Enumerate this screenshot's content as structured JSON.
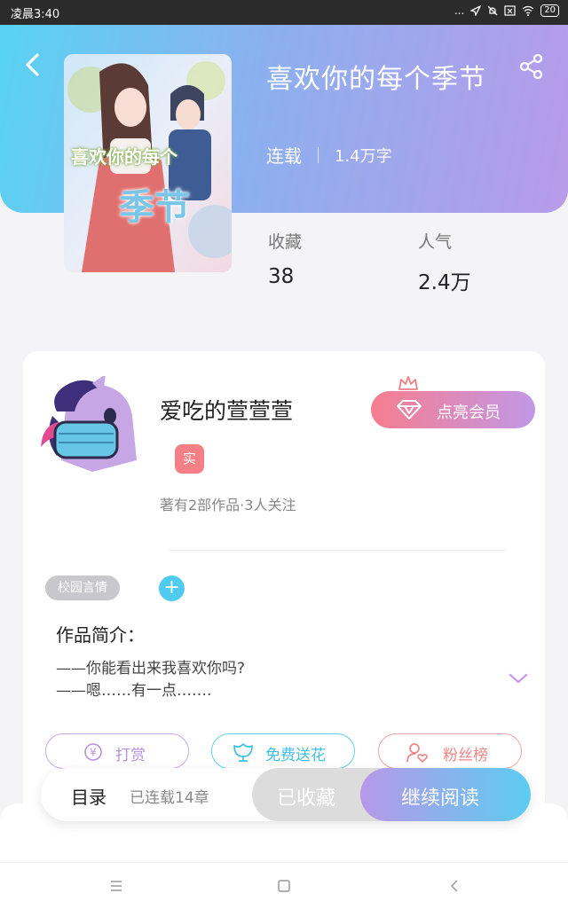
{
  "status_bar": {
    "time": "凌晨3:40",
    "dots": "...",
    "battery": "20"
  },
  "book": {
    "title": "喜欢你的每个季节",
    "status": "连载",
    "word_count": "1.4万字",
    "cover_title_line1": "喜欢你的每个",
    "cover_title_line2": "季节"
  },
  "stats": {
    "favorites": {
      "label": "收藏",
      "value": "38"
    },
    "popularity": {
      "label": "人气",
      "value": "2.4万"
    }
  },
  "author": {
    "name": "爱吃的萱萱萱",
    "badge": "实",
    "meta": "著有2部作品·3人关注",
    "vip_button": "点亮会员"
  },
  "tags": [
    "校园言情"
  ],
  "tag_add": "+",
  "intro": {
    "title": "作品简介：",
    "line1": "——你能看出来我喜欢你吗?",
    "line2": "——嗯……有一点……."
  },
  "actions": {
    "reward": "打赏",
    "flower": "免费送花",
    "fans": "粉丝榜",
    "reward_symbol": "¥"
  },
  "bottom_bar": {
    "toc": "目录",
    "chapter_count": "已连载14章",
    "favorited": "已收藏",
    "continue_reading": "继续阅读"
  },
  "colors": {
    "header_start": "#58d3f3",
    "header_end": "#b89be9",
    "accent_blue": "#4fcbf0",
    "accent_pink": "#f47f86",
    "accent_purple": "#b798e8"
  },
  "icons": [
    "back-arrow-icon",
    "share-icon",
    "crown-icon",
    "diamond-icon",
    "plus-icon",
    "chevron-down-icon",
    "yen-coin-icon",
    "flower-icon",
    "user-heart-icon",
    "menu-icon",
    "home-square-icon",
    "back-triangle-icon"
  ]
}
